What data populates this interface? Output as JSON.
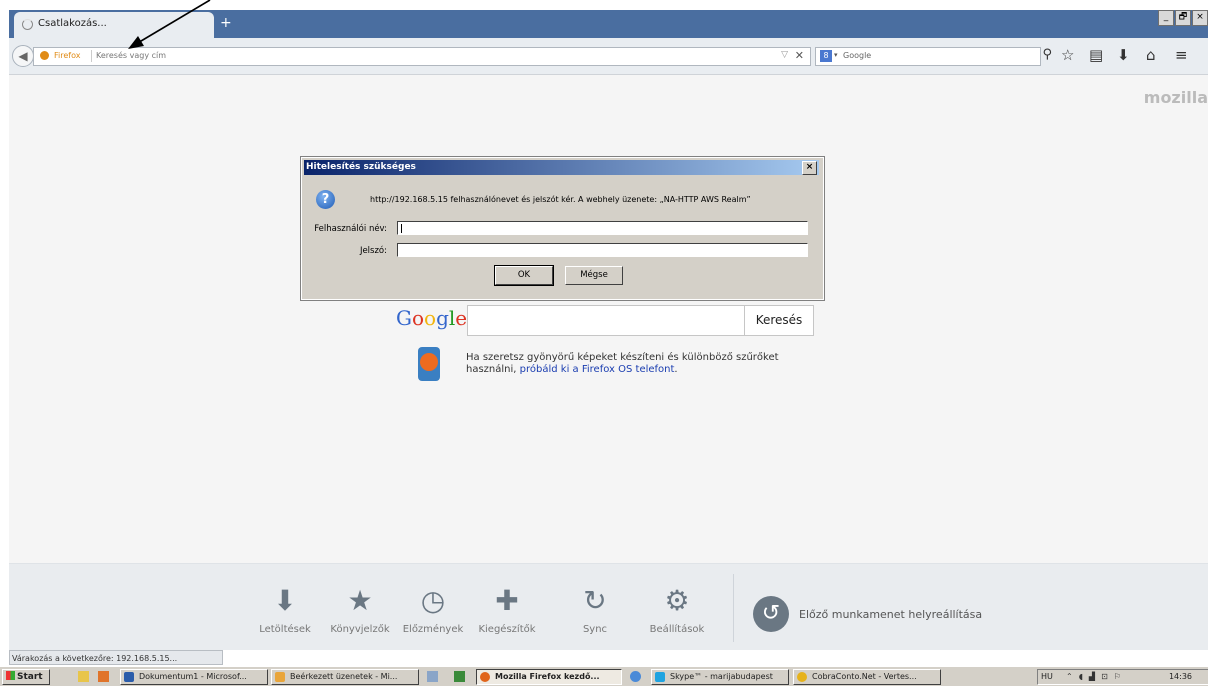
{
  "browser": {
    "tab_title": "Csatlakozás...",
    "new_tab": "+",
    "window_controls": [
      "_",
      "🗗",
      "×"
    ],
    "identity_label": "Firefox",
    "url_placeholder": "Keresés vagy cím",
    "url_clear": "✕",
    "search_engine_icon": "8",
    "search_placeholder": "Google",
    "nav_icons": [
      "search-icon",
      "bookmark-star-icon",
      "bookmarks-menu-icon",
      "downloads-icon",
      "home-icon",
      "menu-icon"
    ]
  },
  "content": {
    "brand": "mozilla",
    "google_logo": "Google",
    "search_button": "Keresés",
    "snippet_text": "Ha szeretsz gyönyörű képeket készíteni és különböző szűrőket használni, ",
    "snippet_link": "próbáld ki a Firefox OS telefont",
    "snippet_end": "."
  },
  "dialog": {
    "title": "Hitelesítés szükséges",
    "close": "×",
    "message": "http://192.168.5.15 felhasználónevet és jelszót kér. A webhely üzenete: „NA-HTTP AWS Realm”",
    "username_label": "Felhasználói név:",
    "username_value": "",
    "password_label": "Jelszó:",
    "password_value": "",
    "ok_label": "OK",
    "cancel_label": "Mégse"
  },
  "launcher": {
    "items": [
      {
        "label": "Letöltések",
        "icon": "download-icon"
      },
      {
        "label": "Könyvjelzők",
        "icon": "bookmark-icon"
      },
      {
        "label": "Előzmények",
        "icon": "history-icon"
      },
      {
        "label": "Kiegészítők",
        "icon": "addons-icon"
      },
      {
        "label": "Sync",
        "icon": "sync-icon"
      },
      {
        "label": "Beállítások",
        "icon": "settings-icon"
      }
    ],
    "restore_label": "Előző munkamenet helyreállítása"
  },
  "status_text": "Várakozás a következőre: 192.168.5.15...",
  "taskbar": {
    "start": "Start",
    "buttons": [
      {
        "label": "Dokumentum1 - Microsof...",
        "color": "#2a5caa"
      },
      {
        "label": "Beérkezett üzenetek - Mi...",
        "color": "#e9a53a"
      },
      {
        "label": "Mozilla Firefox kezdő...",
        "color": "#e0641a"
      },
      {
        "label": "Skype™ - marijabudapest",
        "color": "#1fa3e0"
      },
      {
        "label": "CobraConto.Net - Vertes...",
        "color": "#e6b21a"
      }
    ],
    "lang": "HU",
    "clock": "14:36"
  }
}
